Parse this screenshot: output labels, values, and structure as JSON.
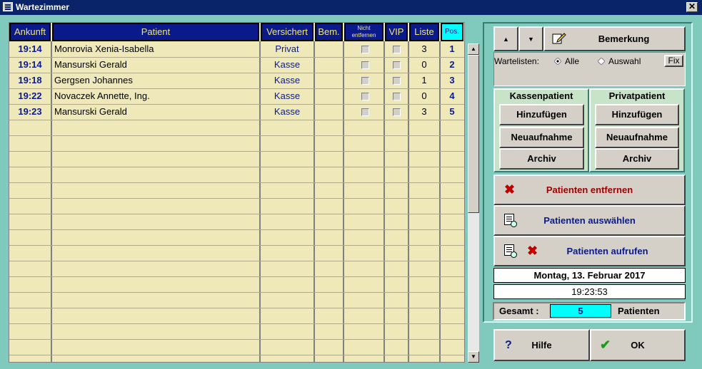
{
  "window": {
    "title": "Wartezimmer"
  },
  "grid": {
    "headers": {
      "arrival": "Ankunft",
      "patient": "Patient",
      "insured": "Versichert",
      "remark": "Bem.",
      "not_remove_1": "Nicht",
      "not_remove_2": "entfernen",
      "vip": "VIP",
      "list": "Liste",
      "pos": "Pos."
    },
    "rows": [
      {
        "time": "19:14",
        "name": "Monrovia Xenia-Isabella",
        "insured": "Privat",
        "list": "3",
        "pos": "1"
      },
      {
        "time": "19:14",
        "name": "Mansurski Gerald",
        "insured": "Kasse",
        "list": "0",
        "pos": "2"
      },
      {
        "time": "19:18",
        "name": "Gergsen Johannes",
        "insured": "Kasse",
        "list": "1",
        "pos": "3"
      },
      {
        "time": "19:22",
        "name": "Novaczek Annette, Ing.",
        "insured": "Kasse",
        "list": "0",
        "pos": "4"
      },
      {
        "time": "19:23",
        "name": "Mansurski Gerald",
        "insured": "Kasse",
        "list": "3",
        "pos": "5"
      }
    ]
  },
  "panel": {
    "remark_button": "Bemerkung",
    "waitlists_label": "Wartelisten:",
    "radio_all": "Alle",
    "radio_selection": "Auswahl",
    "fix_button": "Fix",
    "kassen_header": "Kassenpatient",
    "privat_header": "Privatpatient",
    "add": "Hinzufügen",
    "new_admission": "Neuaufnahme",
    "archive": "Archiv",
    "remove_patients": "Patienten entfernen",
    "select_patients": "Patienten auswählen",
    "call_patients": "Patienten aufrufen",
    "date": "Montag, 13. Februar 2017",
    "time": "19:23:53",
    "total_label": "Gesamt :",
    "total_value": "5",
    "total_unit": "Patienten"
  },
  "footer": {
    "help": "Hilfe",
    "ok": "OK"
  },
  "colors": {
    "background": "#7fc9bd",
    "grid_bg": "#efe9ba",
    "header_bg": "#0a1a8a",
    "header_text": "#f0e680",
    "pos_header_bg": "#00ffff",
    "remove_text": "#a00000",
    "action_text": "#0a1a8a"
  },
  "icons": {
    "up": "arrow-up-icon",
    "down": "arrow-down-icon",
    "remark": "pencil-note-icon",
    "remove": "red-x-icon",
    "select": "document-search-icon",
    "help": "question-icon",
    "ok": "checkmark-icon"
  }
}
